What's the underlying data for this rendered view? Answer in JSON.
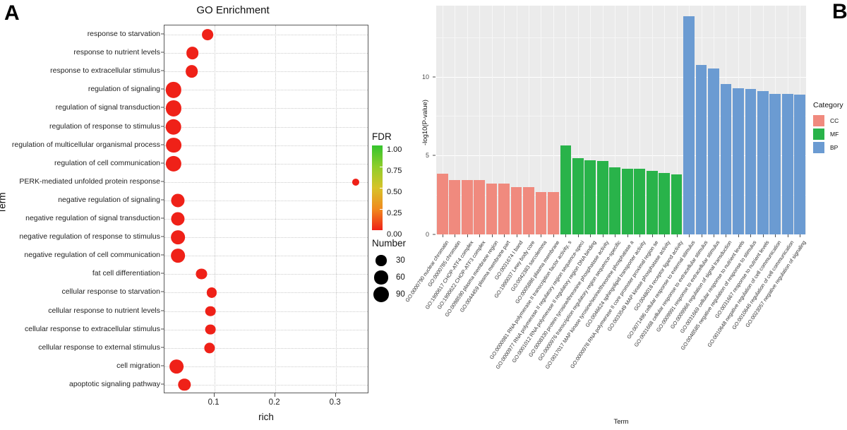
{
  "panels": {
    "a_letter": "A",
    "b_letter": "B"
  },
  "panel_a": {
    "title": "GO Enrichment",
    "xlabel": "rich",
    "ylabel": "Term",
    "xticks": [
      "0.1",
      "0.2",
      "0.3"
    ],
    "fdr_legend": {
      "title": "FDR",
      "ticks": [
        "1.00",
        "0.75",
        "0.50",
        "0.25",
        "0.00"
      ],
      "color_high": "#35c42e",
      "color_low": "#ef2118"
    },
    "number_legend": {
      "title": "Number",
      "sizes": [
        "30",
        "60",
        "90"
      ]
    }
  },
  "panel_b": {
    "ylabel": "-log10(P-value)",
    "xlabel": "Term",
    "yticks": [
      "0",
      "5",
      "10"
    ],
    "legend": {
      "title": "Category",
      "items": [
        {
          "label": "CC",
          "color": "#F08A7E"
        },
        {
          "label": "MF",
          "color": "#29B34A"
        },
        {
          "label": "BP",
          "color": "#6B9BD2"
        }
      ]
    }
  },
  "chart_data": [
    {
      "type": "scatter",
      "title": "GO Enrichment",
      "xlabel": "rich",
      "ylabel": "Term",
      "xlim": [
        0.018,
        0.355
      ],
      "xticks": [
        0.1,
        0.2,
        0.3
      ],
      "grid": true,
      "size_legend": {
        "name": "Number",
        "breaks": [
          30,
          60,
          90
        ]
      },
      "color_legend": {
        "name": "FDR",
        "breaks": [
          0.0,
          0.25,
          0.5,
          0.75,
          1.0
        ],
        "low": "#ef2118",
        "high": "#35c42e"
      },
      "points": [
        {
          "term": "response to starvation",
          "rich": 0.089,
          "number": 33,
          "fdr": 0.0
        },
        {
          "term": "response to nutrient levels",
          "rich": 0.064,
          "number": 48,
          "fdr": 0.0
        },
        {
          "term": "response to extracellular stimulus",
          "rich": 0.063,
          "number": 48,
          "fdr": 0.0
        },
        {
          "term": "regulation of signaling",
          "rich": 0.033,
          "number": 95,
          "fdr": 0.0
        },
        {
          "term": "regulation of signal transduction",
          "rich": 0.033,
          "number": 92,
          "fdr": 0.0
        },
        {
          "term": "regulation of response to stimulus",
          "rich": 0.033,
          "number": 97,
          "fdr": 0.0
        },
        {
          "term": "regulation of multicellular organismal process",
          "rich": 0.033,
          "number": 88,
          "fdr": 0.0
        },
        {
          "term": "regulation of cell communication",
          "rich": 0.033,
          "number": 93,
          "fdr": 0.0
        },
        {
          "term": "PERK-mediated unfolded protein response",
          "rich": 0.333,
          "number": 5,
          "fdr": 0.0
        },
        {
          "term": "negative regulation of signaling",
          "rich": 0.04,
          "number": 60,
          "fdr": 0.0
        },
        {
          "term": "negative regulation of signal transduction",
          "rich": 0.04,
          "number": 60,
          "fdr": 0.0
        },
        {
          "term": "negative regulation of response to stimulus",
          "rich": 0.04,
          "number": 66,
          "fdr": 0.0
        },
        {
          "term": "negative regulation of cell communication",
          "rich": 0.04,
          "number": 66,
          "fdr": 0.0
        },
        {
          "term": "fat cell differentiation",
          "rich": 0.079,
          "number": 28,
          "fdr": 0.0
        },
        {
          "term": "cellular response to starvation",
          "rich": 0.096,
          "number": 22,
          "fdr": 0.0
        },
        {
          "term": "cellular response to nutrient levels",
          "rich": 0.094,
          "number": 25,
          "fdr": 0.0
        },
        {
          "term": "cellular response to extracellular stimulus",
          "rich": 0.094,
          "number": 26,
          "fdr": 0.0
        },
        {
          "term": "cellular response to external stimulus",
          "rich": 0.092,
          "number": 29,
          "fdr": 0.0
        },
        {
          "term": "cell migration",
          "rich": 0.038,
          "number": 67,
          "fdr": 0.0
        },
        {
          "term": "apoptotic signaling pathway",
          "rich": 0.051,
          "number": 45,
          "fdr": 0.0
        }
      ]
    },
    {
      "type": "bar",
      "ylabel": "-log10(P-value)",
      "xlabel": "Term",
      "ylim": [
        0,
        14.5
      ],
      "yticks": [
        0,
        5,
        10
      ],
      "grid": true,
      "legend_position": "right",
      "legend_title": "Category",
      "categories": [
        "GO:0000790 nuclear chromatin",
        "GO:0000785 chromatin",
        "GO:1990617 CHOP-ATF4 complex",
        "GO:1990622 CHOP-ATF3 complex",
        "GO:0098590 plasma membrane region",
        "GO:0044459 plasma membrane part",
        "GO:0031674 I band",
        "GO:1990037 Lewy body core",
        "GO:0042383 sarcolemma",
        "GO:0005886 plasma membrane",
        "GO:0000981 RNA polymerase II transcription factor activity, s",
        "GO:0000977 RNA polymerase II regulatory region sequence-speci",
        "GO:0001012 RNA polymerase II regulatory region DNA binding",
        "GO:0008330 protein tyrosine/threonine phosphatase activity",
        "GO:0000976 transcription regulatory region sequence-specific",
        "GO:0017017 MAP kinase tyrosine/serine/threonine phosphatase a",
        "GO:0046624 sphingolipid transporter activity",
        "GO:0000978 RNA polymerase II core promoter proximal region se",
        "GO:0033549 MAP kinase phosphatase activity",
        "GO:0048018 receptor ligand activity",
        "GO:0071496 cellular response to external stimulus",
        "GO:0031668 cellular response to extracellular stimulus",
        "GO:0009991 response to extracellular stimulus",
        "GO:0009966 regulation of signal transduction",
        "GO:0031669 cellular response to nutrient levels",
        "GO:0048585 negative regulation of response to stimulus",
        "GO:0031667 response to nutrient levels",
        "GO:0010648 negative regulation of cell communication",
        "GO:0010646 regulation of cell communication",
        "GO:0023057 negative regulation of signaling"
      ],
      "values": [
        3.85,
        3.45,
        3.45,
        3.45,
        3.22,
        3.22,
        3.02,
        3.0,
        2.7,
        2.7,
        5.62,
        4.82,
        4.72,
        4.65,
        4.25,
        4.18,
        4.18,
        4.05,
        3.88,
        3.82,
        13.85,
        10.72,
        10.5,
        9.55,
        9.25,
        9.22,
        9.1,
        8.92,
        8.92,
        8.88
      ],
      "series": [
        {
          "name": "CC",
          "color": "#F08A7E",
          "indices": [
            0,
            1,
            2,
            3,
            4,
            5,
            6,
            7,
            8,
            9
          ]
        },
        {
          "name": "MF",
          "color": "#29B34A",
          "indices": [
            10,
            11,
            12,
            13,
            14,
            15,
            16,
            17,
            18,
            19
          ]
        },
        {
          "name": "BP",
          "color": "#6B9BD2",
          "indices": [
            20,
            21,
            22,
            23,
            24,
            25,
            26,
            27,
            28,
            29
          ]
        }
      ]
    }
  ]
}
